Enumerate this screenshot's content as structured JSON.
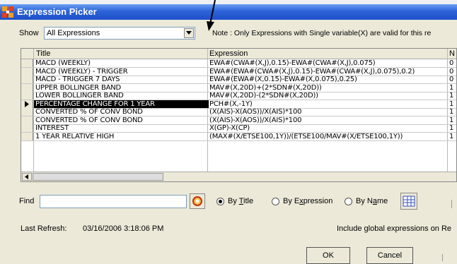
{
  "window": {
    "title": "Expression Picker",
    "corner_text": "..."
  },
  "show": {
    "label": "Show",
    "value": "All Expressions"
  },
  "note": "Note : Only Expressions with Single variable(X) are valid for this re",
  "grid": {
    "columns": [
      "Title",
      "Expression",
      "N"
    ],
    "rows": [
      {
        "title": "MACD (WEEKLY)",
        "expression": "EWA#(CWA#(X,J),0.15)-EWA#(CWA#(X,J),0.075)",
        "n": "0"
      },
      {
        "title": "MACD (WEEKLY) - TRIGGER",
        "expression": "EWA#(EWA#(CWA#(X,J),0.15)-EWA#(CWA#(X,J),0.075),0.2)",
        "n": "0"
      },
      {
        "title": "MACD - TRIGGER 7 DAYS",
        "expression": "EWA#(EWA#(X,0.15)-EWA#(X,0.075),0.25)",
        "n": "0"
      },
      {
        "title": "UPPER BOLLINGER BAND",
        "expression": "MAV#(X,20D)+(2*SDN#(X,20D))",
        "n": "1"
      },
      {
        "title": "LOWER BOLLINGER BAND",
        "expression": "MAV#(X,20D)-(2*SDN#(X,20D))",
        "n": "1"
      },
      {
        "title": "PERCENTAGE CHANGE FOR 1 YEAR",
        "expression": "PCH#(X,-1Y)",
        "n": "1"
      },
      {
        "title": "CONVERTED % OF CONV BOND",
        "expression": "(X(AIS)-X(AOS))/X(AIS)*100",
        "n": "1"
      },
      {
        "title": "CONVERTED % OF CONV BOND",
        "expression": "(X(AIS)-X(AOS))/X(AIS)*100",
        "n": "1"
      },
      {
        "title": "INTEREST",
        "expression": "X(GP)-X(CP)",
        "n": "1"
      },
      {
        "title": "1 YEAR RELATIVE HIGH",
        "expression": "(MAX#(X/ETSE100,1Y))/(ETSE100/MAV#(X/ETSE100,1Y))",
        "n": "1"
      }
    ],
    "selected_index": 5
  },
  "find": {
    "label": "Find",
    "value": ""
  },
  "search_by": {
    "options": [
      {
        "label": "By Title",
        "selected": true
      },
      {
        "label": "By Expression",
        "selected": false
      },
      {
        "label": "By Name",
        "selected": false
      }
    ]
  },
  "last_refresh": {
    "label": "Last Refresh:",
    "value": "03/16/2006 3:18:06 PM"
  },
  "include_global": "Include global expressions on Re",
  "buttons": {
    "ok": "OK",
    "cancel": "Cancel"
  },
  "colors": {
    "titlebar": "#2c62d8",
    "window_bg": "#ECE9D8",
    "selected_row": "#000000"
  }
}
